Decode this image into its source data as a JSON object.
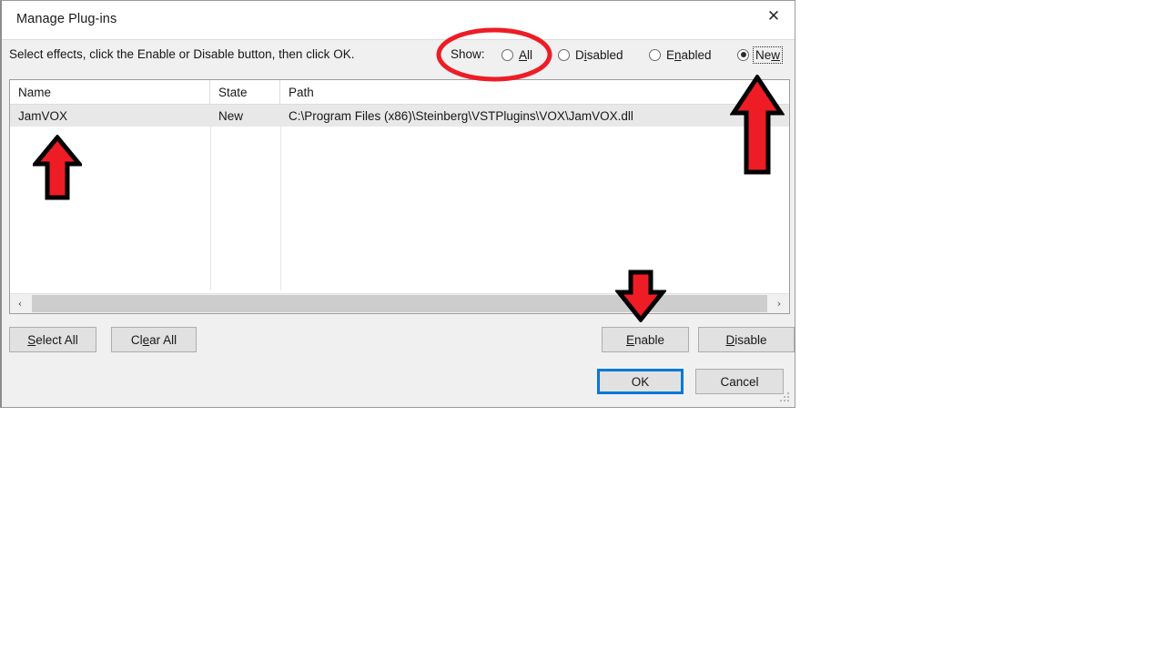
{
  "window": {
    "title": "Manage Plug-ins",
    "close_icon": "close-icon",
    "close_glyph": "✕"
  },
  "instruction": {
    "text": "Select effects, click the Enable or Disable button, then click OK."
  },
  "show_filter": {
    "label": "Show:",
    "options": [
      {
        "label_before": "",
        "accel": "A",
        "label_after": "ll",
        "full": "All",
        "checked": false,
        "focused": false
      },
      {
        "label_before": "D",
        "accel": "i",
        "label_after": "sabled",
        "full": "Disabled",
        "checked": false,
        "focused": false
      },
      {
        "label_before": "E",
        "accel": "n",
        "label_after": "abled",
        "full": "Enabled",
        "checked": false,
        "focused": false
      },
      {
        "label_before": "Ne",
        "accel": "w",
        "label_after": "",
        "full": "New",
        "checked": true,
        "focused": true
      }
    ]
  },
  "list": {
    "columns": [
      {
        "label": "Name"
      },
      {
        "label": "State"
      },
      {
        "label": "Path"
      }
    ],
    "rows": [
      {
        "name": "JamVOX",
        "state": "New",
        "path": "C:\\Program Files (x86)\\Steinberg\\VSTPlugins\\VOX\\JamVOX.dll",
        "selected": true
      }
    ],
    "scrollbar": {
      "left_arrow_glyph": "‹",
      "right_arrow_glyph": "›",
      "left_icon": "scroll-left-icon",
      "right_icon": "scroll-right-icon"
    }
  },
  "buttons": {
    "select_all": {
      "before": "",
      "accel": "S",
      "after": "elect All",
      "full": "Select All"
    },
    "clear_all": {
      "before": "Cl",
      "accel": "e",
      "after": "ar All",
      "full": "Clear All"
    },
    "enable": {
      "before": "",
      "accel": "E",
      "after": "nable",
      "full": "Enable"
    },
    "disable": {
      "before": "",
      "accel": "D",
      "after": "isable",
      "full": "Disable"
    },
    "ok": {
      "before": "OK",
      "accel": "",
      "after": "",
      "full": "OK"
    },
    "cancel": {
      "before": "Cancel",
      "accel": "",
      "after": "",
      "full": "Cancel"
    }
  },
  "annotations": {
    "accent_color": "#ee1c25",
    "outline_color": "#000000",
    "ellipse": {
      "name": "highlight-ellipse-show-all"
    },
    "arrow_name": {
      "name": "callout-arrow-name-column",
      "direction": "up"
    },
    "arrow_right": {
      "name": "callout-arrow-path-row",
      "direction": "up"
    },
    "arrow_down": {
      "name": "callout-arrow-enable-button",
      "direction": "down"
    }
  }
}
